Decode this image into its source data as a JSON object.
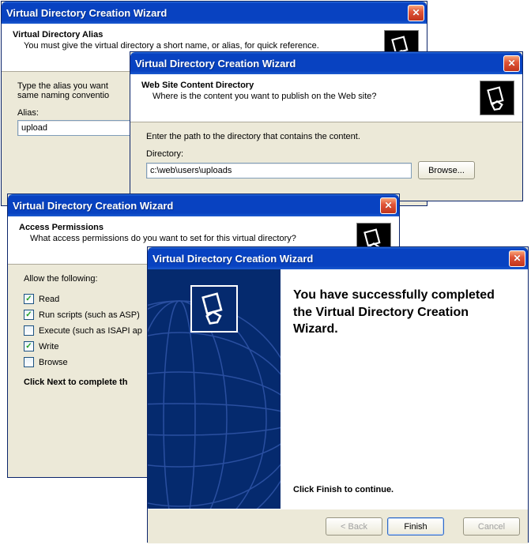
{
  "win1": {
    "title": "Virtual Directory Creation Wizard",
    "head": "Virtual Directory Alias",
    "sub": "You must give the virtual directory a short name, or alias, for quick reference.",
    "instr1": "Type the alias you want",
    "instr2": "same naming conventio",
    "alias_label": "Alias:",
    "alias_value": "upload"
  },
  "win2": {
    "title": "Virtual Directory Creation Wizard",
    "head": "Web Site Content Directory",
    "sub": "Where is the content you want to publish on the Web site?",
    "instr": "Enter the path to the directory that contains the content.",
    "dir_label": "Directory:",
    "dir_value": "c:\\web\\users\\uploads",
    "browse": "Browse..."
  },
  "win3": {
    "title": "Virtual Directory Creation Wizard",
    "head": "Access Permissions",
    "sub": "What access permissions do you want to set for this virtual directory?",
    "allow": "Allow the following:",
    "opts": {
      "read": "Read",
      "scripts": "Run scripts (such as ASP)",
      "exec": "Execute (such as ISAPI ap",
      "write": "Write",
      "browse": "Browse"
    },
    "click_next": "Click Next to complete th"
  },
  "win4": {
    "title": "Virtual Directory Creation Wizard",
    "headline": "You have successfully completed the Virtual Directory Creation Wizard.",
    "note": "Click Finish to continue.",
    "back": "< Back",
    "finish": "Finish",
    "cancel": "Cancel"
  }
}
